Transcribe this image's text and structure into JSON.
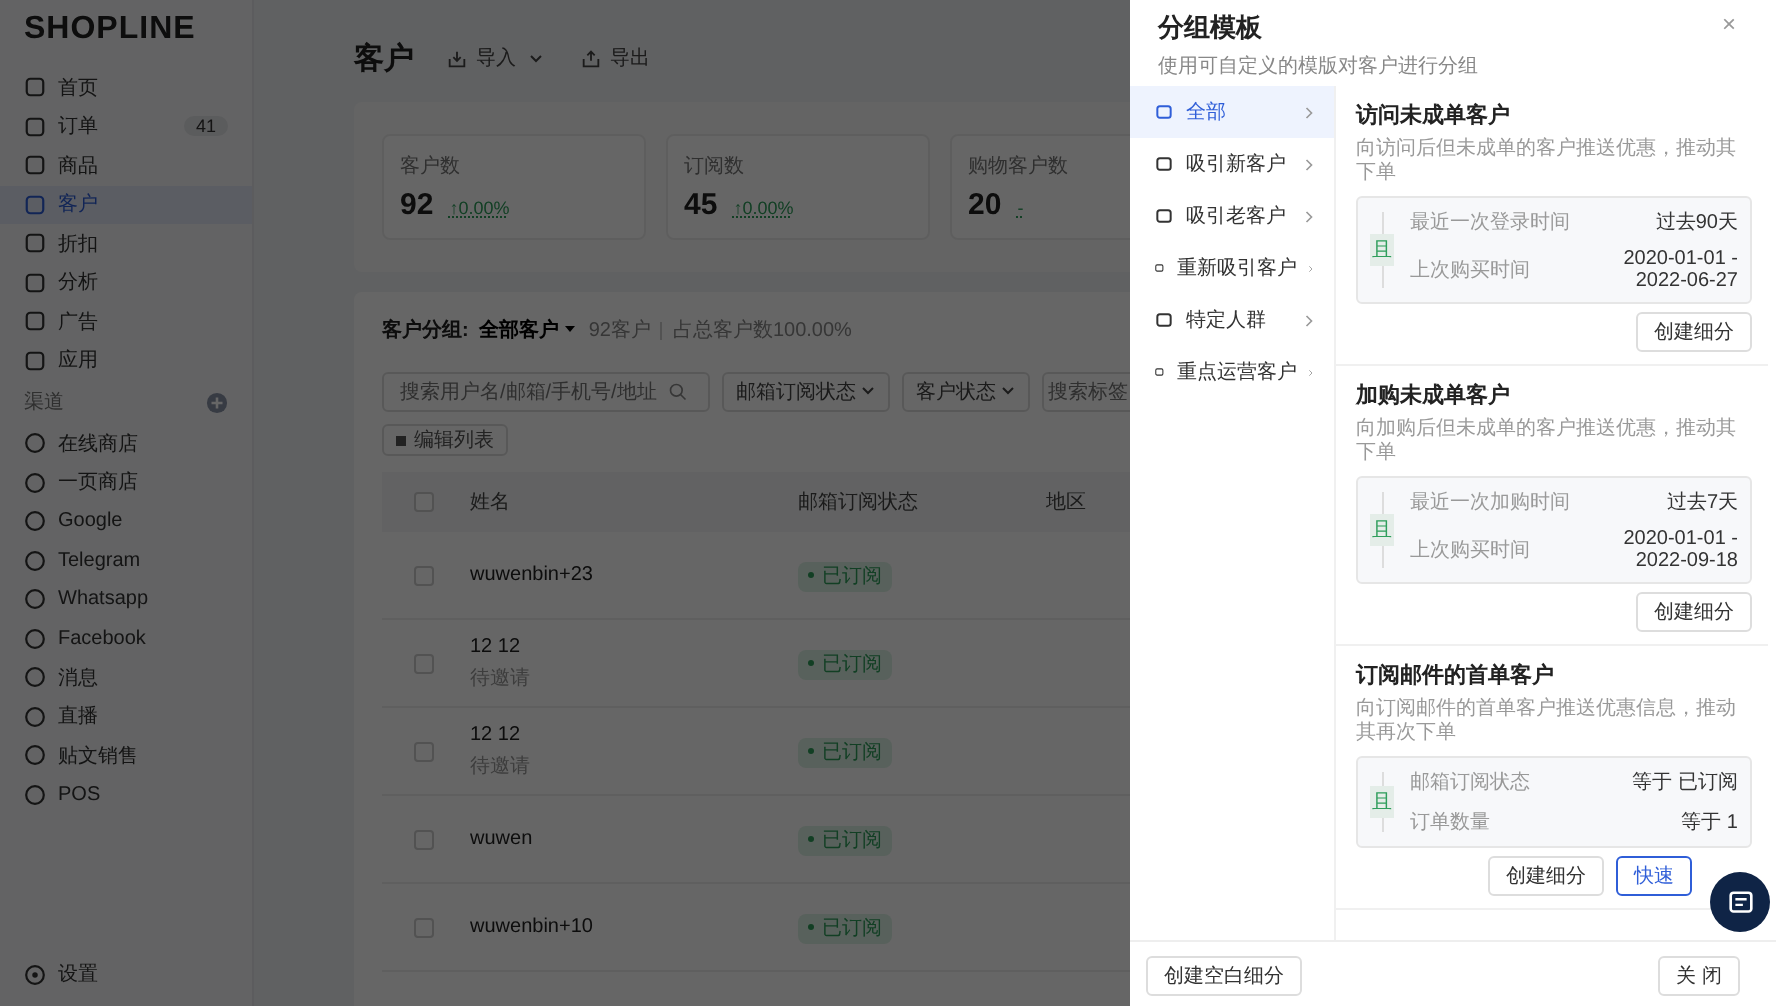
{
  "brand": "SHOPLINE",
  "sidebar": {
    "items": [
      {
        "label": "首页",
        "selected": false
      },
      {
        "label": "订单",
        "badge": "41",
        "selected": false
      },
      {
        "label": "商品",
        "selected": false
      },
      {
        "label": "客户",
        "selected": true
      },
      {
        "label": "折扣",
        "selected": false
      },
      {
        "label": "分析",
        "selected": false
      },
      {
        "label": "广告",
        "selected": false
      },
      {
        "label": "应用",
        "selected": false
      }
    ],
    "channels_header": "渠道",
    "channels": [
      {
        "label": "在线商店"
      },
      {
        "label": "一页商店"
      },
      {
        "label": "Google"
      },
      {
        "label": "Telegram"
      },
      {
        "label": "Whatsapp"
      },
      {
        "label": "Facebook"
      },
      {
        "label": "消息"
      },
      {
        "label": "直播"
      },
      {
        "label": "贴文销售"
      },
      {
        "label": "POS"
      }
    ],
    "settings": "设置"
  },
  "header": {
    "title": "客户",
    "import": "导入",
    "export": "导出"
  },
  "stats": [
    {
      "label": "客户数",
      "value": "92",
      "change": "↑0.00%"
    },
    {
      "label": "订阅数",
      "value": "45",
      "change": "↑0.00%"
    },
    {
      "label": "购物客户数",
      "value": "20",
      "change": "-"
    }
  ],
  "segment": {
    "label": "客户分组:",
    "current": "全部客户",
    "count": "92客户",
    "share": "占总客户数100.00%"
  },
  "filters": {
    "search_placeholder": "搜索用户名/邮箱/手机号/地址",
    "dropdowns": [
      "邮箱订阅状态",
      "客户状态"
    ],
    "tag_placeholder": "搜索标签",
    "chip": "编辑列表"
  },
  "table": {
    "columns": [
      "姓名",
      "邮箱订阅状态",
      "地区"
    ],
    "all_checked": false,
    "rows": [
      {
        "name": "wuwenbin+23",
        "status": "已订阅",
        "checked": false
      },
      {
        "name": "12 12",
        "note": "待邀请",
        "status": "已订阅",
        "checked": false
      },
      {
        "name": "12 12",
        "note": "待邀请",
        "status": "已订阅",
        "checked": false
      },
      {
        "name": "wuwen",
        "status": "已订阅",
        "checked": false
      },
      {
        "name": "wuwenbin+10",
        "status": "已订阅",
        "checked": false
      }
    ]
  },
  "drawer": {
    "title": "分组模板",
    "subtitle": "使用可自定义的模版对客户进行分组",
    "close": "×",
    "menu": [
      {
        "label": "全部",
        "selected": true
      },
      {
        "label": "吸引新客户",
        "selected": false
      },
      {
        "label": "吸引老客户",
        "selected": false
      },
      {
        "label": "重新吸引客户",
        "selected": false
      },
      {
        "label": "特定人群",
        "selected": false
      },
      {
        "label": "重点运营客户",
        "selected": false
      }
    ],
    "templates": [
      {
        "title": "访问未成单客户",
        "desc": "向访问后但未成单的客户推送优惠，推动其下单",
        "connector": "且",
        "conditions": [
          {
            "label": "最近一次登录时间",
            "value": "过去90天"
          },
          {
            "label": "上次购买时间",
            "value": "2020-01-01 - 2022-06-27"
          }
        ],
        "buttons": [
          {
            "label": "创建细分",
            "kind": "default"
          }
        ]
      },
      {
        "title": "加购未成单客户",
        "desc": "向加购后但未成单的客户推送优惠，推动其下单",
        "connector": "且",
        "conditions": [
          {
            "label": "最近一次加购时间",
            "value": "过去7天"
          },
          {
            "label": "上次购买时间",
            "value": "2020-01-01 - 2022-09-18"
          }
        ],
        "buttons": [
          {
            "label": "创建细分",
            "kind": "default"
          }
        ]
      },
      {
        "title": "订阅邮件的首单客户",
        "desc": "向订阅邮件的首单客户推送优惠信息，推动其再次下单",
        "connector": "且",
        "conditions": [
          {
            "label": "邮箱订阅状态",
            "value": "等于 已订阅"
          },
          {
            "label": "订单数量",
            "value": "等于 1"
          }
        ],
        "buttons": [
          {
            "label": "创建细分",
            "kind": "default"
          },
          {
            "label": "快速",
            "kind": "primary"
          }
        ]
      }
    ],
    "footer": {
      "left": "创建空白细分",
      "right": "关 闭"
    }
  }
}
